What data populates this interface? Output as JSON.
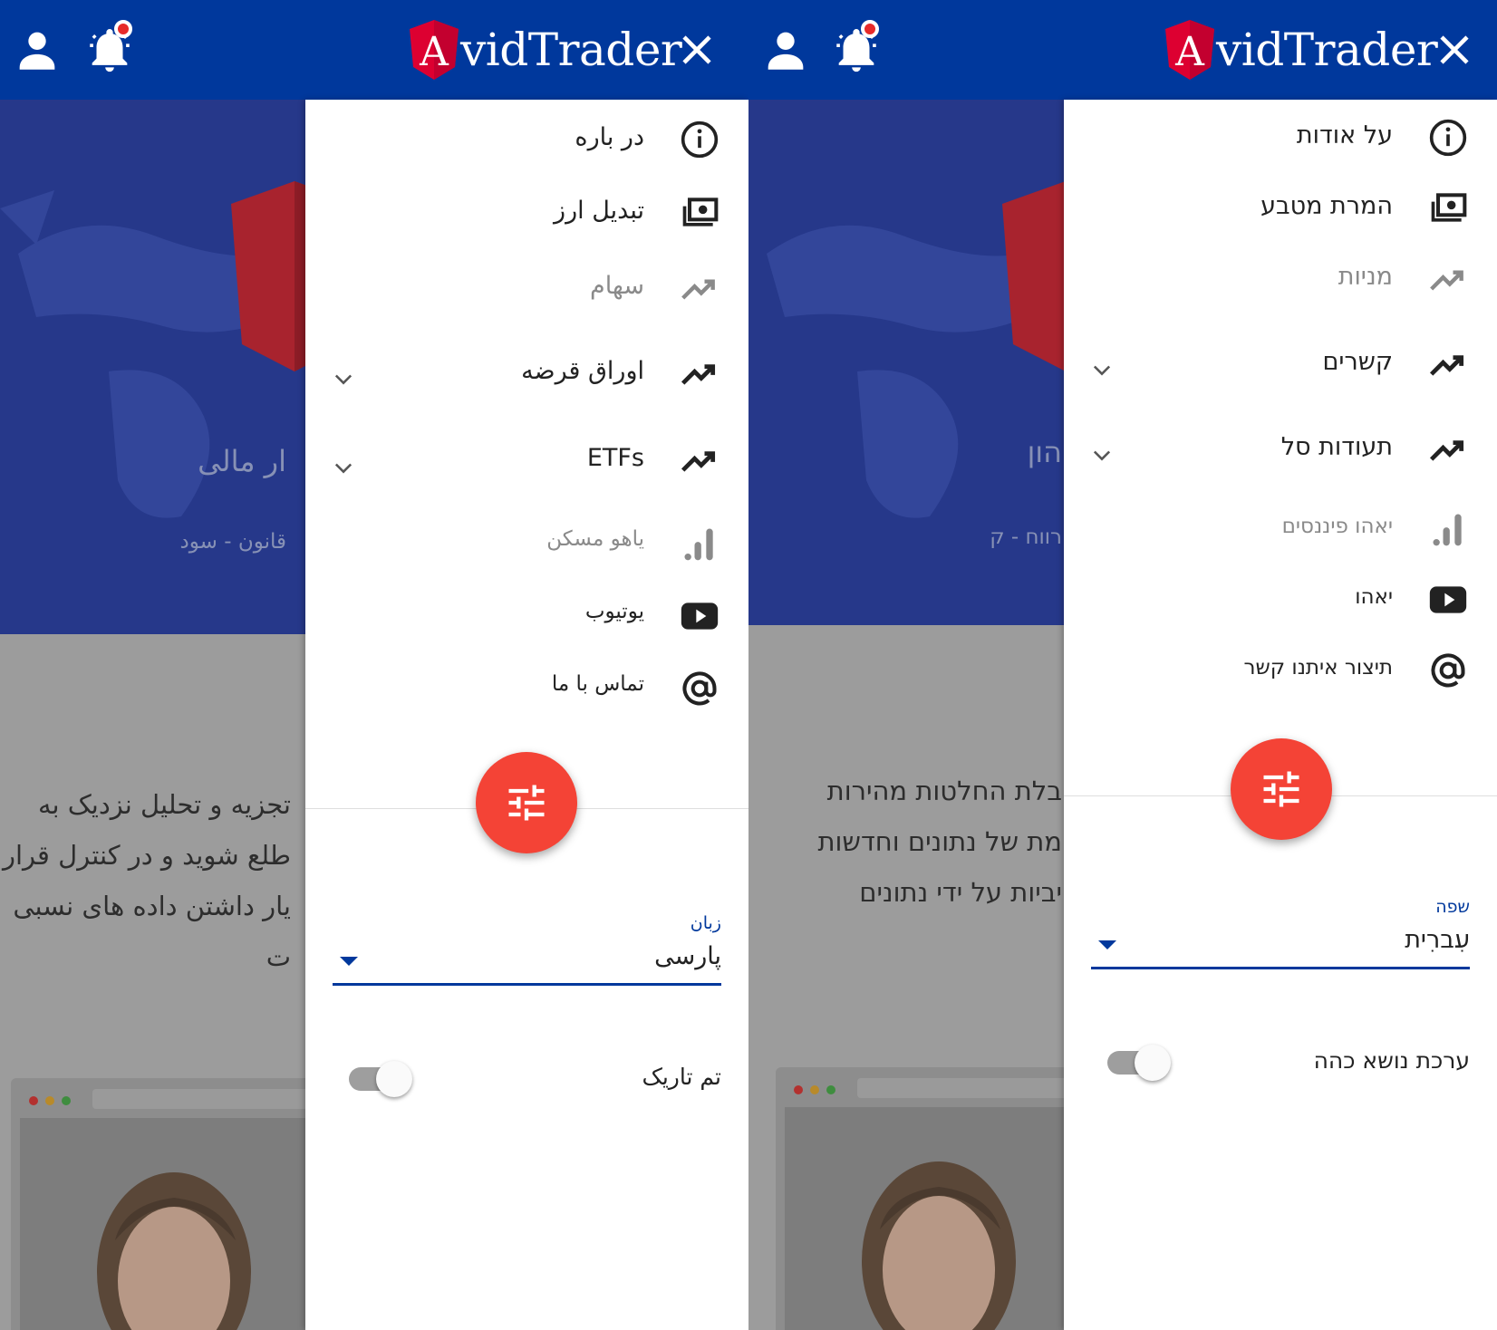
{
  "colors": {
    "header": "#00389c",
    "fab": "#f44336",
    "accent": "#00389c"
  },
  "app": {
    "logo_letter": "A",
    "logo_text": "vidTrader"
  },
  "fa": {
    "menu": [
      {
        "label": "در باره",
        "icon": "info-icon"
      },
      {
        "label": "تبدیل ارز",
        "icon": "money-icon"
      },
      {
        "label": "سهام",
        "icon": "trending-up-icon"
      },
      {
        "label": "اوراق قرضه",
        "icon": "trending-up-icon"
      },
      {
        "label": "ETFs",
        "icon": "trending-up-icon"
      },
      {
        "label": "یاهو مسکن",
        "icon": "signal-bars-icon"
      },
      {
        "label": "یوتیوب",
        "icon": "youtube-icon"
      },
      {
        "label": "تماس با ما",
        "icon": "at-sign-icon"
      }
    ],
    "language_label": "زبان",
    "language_value": "پارسی",
    "theme_label": "تم تاریک",
    "hero_title": "ار مالی",
    "hero_sub": "قانون - سود",
    "body_lines": [
      "تجزیه و تحلیل نزدیک به",
      "طلع شوید و در کنترل قرار",
      "یار داشتن داده های نسبی",
      "ت"
    ]
  },
  "he": {
    "menu": [
      {
        "label": "על אודות",
        "icon": "info-icon"
      },
      {
        "label": "המרת מטבע",
        "icon": "money-icon"
      },
      {
        "label": "מניות",
        "icon": "trending-up-icon"
      },
      {
        "label": "קשרים",
        "icon": "trending-up-icon"
      },
      {
        "label": "תעודות סל",
        "icon": "trending-up-icon"
      },
      {
        "label": "יאהו פיננסים",
        "icon": "signal-bars-icon"
      },
      {
        "label": "יאהו",
        "icon": "youtube-icon"
      },
      {
        "label": "תיצור איתנו קשר",
        "icon": "at-sign-icon"
      }
    ],
    "language_label": "שפה",
    "language_value": "עִברִית",
    "theme_label": "ערכת נושא כהה",
    "hero_title": "הון",
    "hero_sub": "רווח - ק",
    "body_lines": [
      "בלת החלטות מהירות",
      "מת של נתונים וחדשות",
      "יביות על ידי נתונים"
    ]
  }
}
